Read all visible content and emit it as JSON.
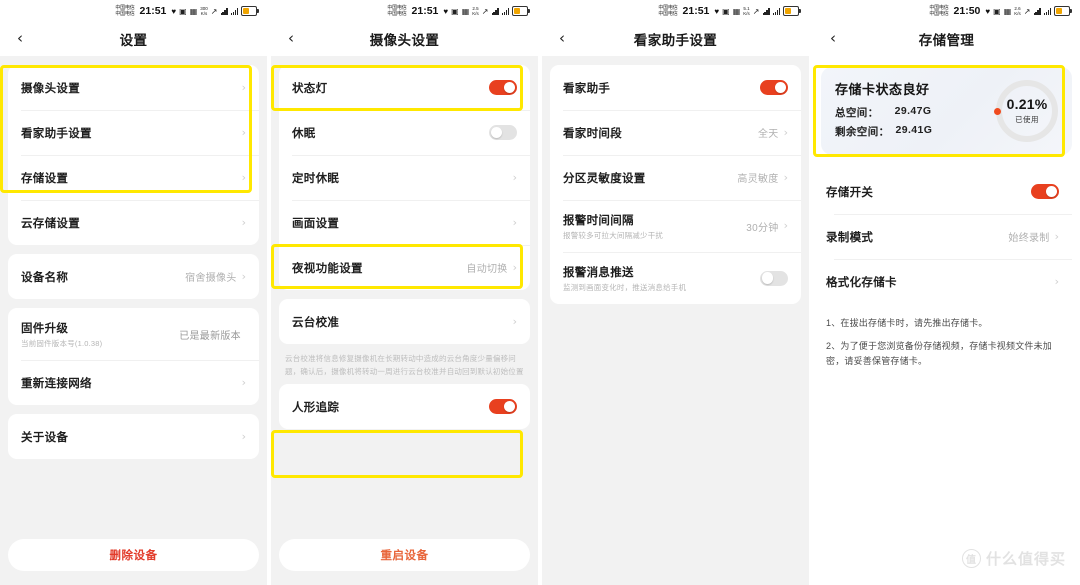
{
  "statusbar": {
    "carrier_line1": "中国电信",
    "carrier_line2": "中国电信",
    "times": [
      "21:51",
      "21:51",
      "21:51",
      "21:50"
    ],
    "speeds": [
      "300",
      "2.5",
      "5.1",
      "2.6"
    ],
    "speed_unit": "K/s",
    "heart_icon": "heart-icon",
    "wifi_icon": "wifi-icon",
    "battery_icon": "battery-icon"
  },
  "panel1": {
    "title": "设置",
    "back_icon": "back-chevron-icon",
    "group1": [
      {
        "label": "摄像头设置",
        "value": "",
        "chevron": "›"
      },
      {
        "label": "看家助手设置",
        "value": "",
        "chevron": "›"
      },
      {
        "label": "存储设置",
        "value": "",
        "chevron": "›"
      },
      {
        "label": "云存储设置",
        "value": "",
        "chevron": "›"
      }
    ],
    "group2": [
      {
        "label": "设备名称",
        "value": "宿舍摄像头",
        "chevron": "›"
      }
    ],
    "group3": [
      {
        "label": "固件升级",
        "sub": "当前固件版本号(1.0.38)",
        "value": "已是最新版本",
        "chevron": ""
      },
      {
        "label": "重新连接网络",
        "value": "",
        "chevron": "›"
      }
    ],
    "group4": [
      {
        "label": "关于设备",
        "value": "",
        "chevron": "›"
      }
    ],
    "delete_button": "删除设备"
  },
  "panel2": {
    "title": "摄像头设置",
    "back_icon": "back-chevron-icon",
    "group1": [
      {
        "label": "状态灯",
        "type": "toggle",
        "state": "on"
      },
      {
        "label": "休眠",
        "type": "toggle",
        "state": "off"
      },
      {
        "label": "定时休眠",
        "type": "link",
        "value": "",
        "chevron": "›"
      },
      {
        "label": "画面设置",
        "type": "link",
        "value": "",
        "chevron": "›"
      },
      {
        "label": "夜视功能设置",
        "type": "link",
        "value": "自动切换",
        "chevron": "›"
      }
    ],
    "group2": [
      {
        "label": "云台校准",
        "type": "link",
        "value": "",
        "chevron": "›"
      }
    ],
    "helper": "云台校准将信息修复摄像机在长期转动中造成的云台角度少量偏移问题，确认后，摄像机将转动一周进行云台校准并自动回到默认初始位置",
    "group3": [
      {
        "label": "人形追踪",
        "type": "toggle",
        "state": "on"
      }
    ],
    "restart_button": "重启设备"
  },
  "panel3": {
    "title": "看家助手设置",
    "back_icon": "back-chevron-icon",
    "group1": [
      {
        "label": "看家助手",
        "type": "toggle",
        "state": "on"
      },
      {
        "label": "看家时间段",
        "type": "link",
        "value": "全天",
        "chevron": "›"
      },
      {
        "label": "分区灵敏度设置",
        "type": "link",
        "value": "高灵敏度",
        "chevron": "›"
      },
      {
        "label": "报警时间间隔",
        "sub": "报警较多可拉大间隔减少干扰",
        "type": "link",
        "value": "30分钟",
        "chevron": "›"
      },
      {
        "label": "报警消息推送",
        "sub": "监测到画面变化时，推送消息给手机",
        "type": "toggle",
        "state": "off"
      }
    ]
  },
  "panel4": {
    "title": "存储管理",
    "back_icon": "back-chevron-icon",
    "storage_card": {
      "title": "存储卡状态良好",
      "total_label": "总空间：",
      "total_value": "29.47G",
      "free_label": "剩余空间：",
      "free_value": "29.41G",
      "percent": "0.21%",
      "percent_caption": "已使用"
    },
    "group1": [
      {
        "label": "存储开关",
        "type": "toggle",
        "state": "on"
      },
      {
        "label": "录制模式",
        "type": "link",
        "value": "始终录制",
        "chevron": "›"
      },
      {
        "label": "格式化存储卡",
        "type": "link",
        "value": "",
        "chevron": "›"
      }
    ],
    "notes": [
      "1、在拔出存储卡时，请先推出存储卡。",
      "2、为了便于您浏览备份存储视频，存储卡视频文件未加密，请妥善保管存储卡。"
    ]
  },
  "watermark": {
    "mark": "值",
    "text": "什么值得买"
  },
  "colors": {
    "toggle_on": "#e8401f",
    "toggle_off": "#e3e3e3",
    "highlight": "#ffe800",
    "delete_text": "#e23c2b",
    "restart_text": "#e8653a",
    "background": "#f2f2f2",
    "card": "#ffffff"
  }
}
